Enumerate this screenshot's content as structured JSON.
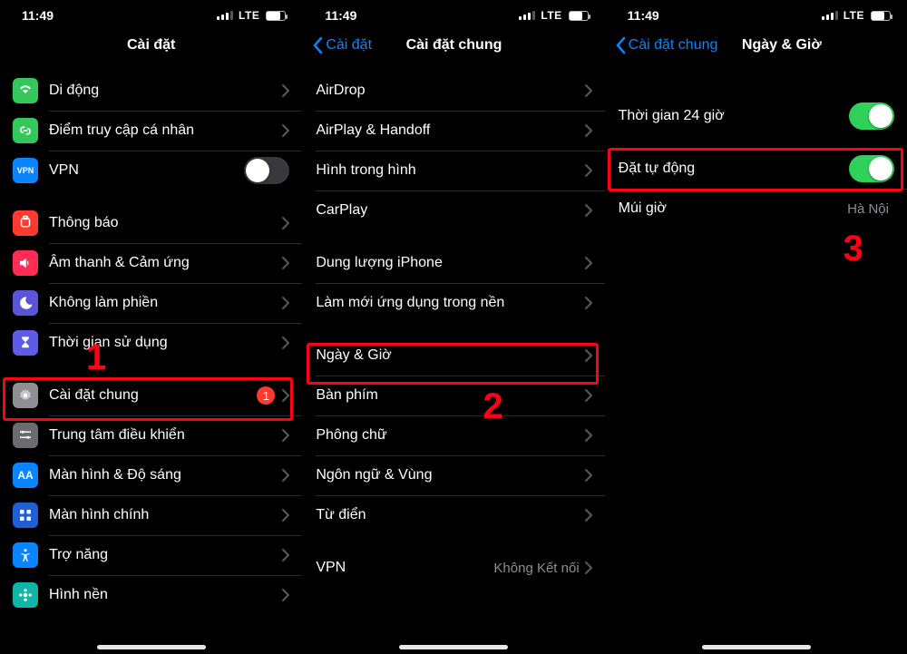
{
  "status": {
    "time": "11:49",
    "net": "LTE"
  },
  "screen1": {
    "title": "Cài đặt",
    "items": {
      "cellular": "Di động",
      "hotspot": "Điểm truy cập cá nhân",
      "vpn": "VPN",
      "notifications": "Thông báo",
      "sounds": "Âm thanh & Cảm ứng",
      "dnd": "Không làm phiền",
      "screentime": "Thời gian sử dụng",
      "general": "Cài đặt chung",
      "general_badge": "1",
      "control_center": "Trung tâm điều khiển",
      "display": "Màn hình & Độ sáng",
      "homescreen": "Màn hình chính",
      "accessibility": "Trợ năng",
      "wallpaper": "Hình nền"
    },
    "step_label": "1"
  },
  "screen2": {
    "back": "Cài đặt",
    "title": "Cài đặt chung",
    "items": {
      "airdrop": "AirDrop",
      "airplay": "AirPlay & Handoff",
      "pip": "Hình trong hình",
      "carplay": "CarPlay",
      "storage": "Dung lượng iPhone",
      "bgrefresh": "Làm mới ứng dụng trong nền",
      "datetime": "Ngày & Giờ",
      "keyboard": "Bàn phím",
      "fonts": "Phông chữ",
      "language": "Ngôn ngữ & Vùng",
      "dictionary": "Từ điển",
      "vpn": "VPN",
      "vpn_value": "Không Kết nối"
    },
    "step_label": "2"
  },
  "screen3": {
    "back": "Cài đặt chung",
    "title": "Ngày & Giờ",
    "items": {
      "twentyfour": "Thời gian 24 giờ",
      "setauto": "Đặt tự động",
      "timezone": "Múi giờ",
      "timezone_value": "Hà Nội"
    },
    "step_label": "3"
  }
}
